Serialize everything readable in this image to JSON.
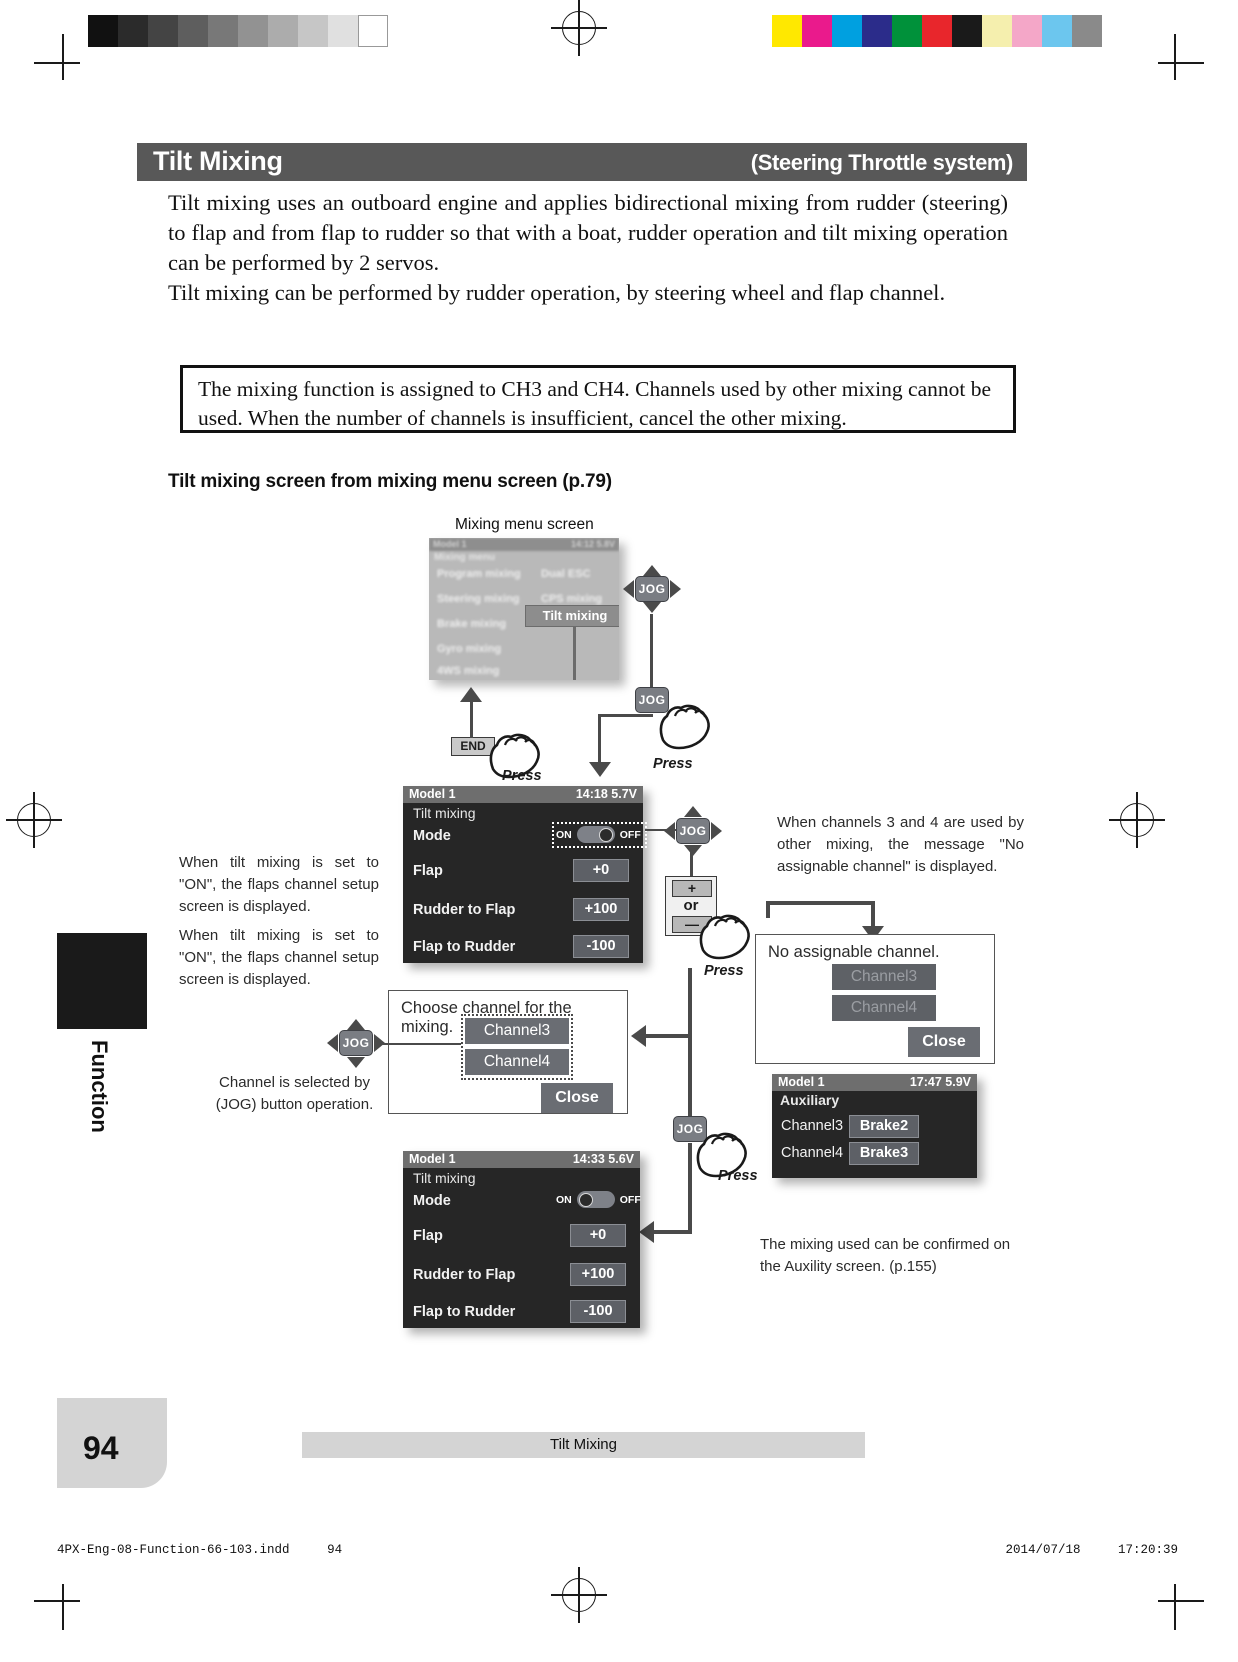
{
  "header": {
    "title": "Tilt Mixing",
    "subtitle": "(Steering Throttle system)"
  },
  "intro": {
    "paragraph1": "Tilt mixing uses an outboard engine and applies bidirectional mixing from rudder (steering) to flap and from flap to rudder so that with a boat, rudder operation and tilt mixing operation can be performed by 2 servos.",
    "paragraph2": "Tilt mixing can be performed by rudder operation, by steering wheel and flap channel."
  },
  "note_box": {
    "text": "The mixing function is assigned to CH3 and CH4. Channels used by other mixing cannot be used. When the number of channels is insufficient, cancel the other mixing."
  },
  "section_heading": "Tilt mixing screen from mixing menu screen (p.79)",
  "mixing_menu": {
    "caption": "Mixing menu screen",
    "model": "Model 1",
    "time": "14:12 5.8V",
    "screen_title": "Mixing menu",
    "items_left": [
      "Program mixing",
      "Steering mixing",
      "Brake mixing",
      "Gyro mixing",
      "4WS mixing"
    ],
    "items_right": [
      "Dual ESC",
      "CPS mixing"
    ],
    "highlighted": "Tilt mixing"
  },
  "screen_top": {
    "model": "Model 1",
    "time": "14:18 5.7V",
    "screen_title": "Tilt mixing",
    "rows": [
      {
        "label": "Mode",
        "value": "ON"
      },
      {
        "label": "Flap",
        "value": "+0"
      },
      {
        "label": "Rudder to Flap",
        "value": "+100"
      },
      {
        "label": "Flap to Rudder",
        "value": "-100"
      }
    ],
    "toggle_on": "ON",
    "toggle_off": "OFF",
    "toggle_state": "ON"
  },
  "screen_bottom": {
    "model": "Model 1",
    "time": "14:33 5.6V",
    "screen_title": "Tilt mixing",
    "rows": [
      {
        "label": "Mode",
        "value": "OFF"
      },
      {
        "label": "Flap",
        "value": "+0"
      },
      {
        "label": "Rudder to Flap",
        "value": "+100"
      },
      {
        "label": "Flap to Rudder",
        "value": "-100"
      }
    ],
    "toggle_on": "ON",
    "toggle_off": "OFF",
    "toggle_state": "OFF"
  },
  "dialog_choose": {
    "title": "Choose channel for the mixing.",
    "option1": "Channel3",
    "option2": "Channel4",
    "close": "Close"
  },
  "dialog_noassign": {
    "title": "No assignable channel.",
    "option1": "Channel3",
    "option2": "Channel4",
    "close": "Close"
  },
  "screen_aux": {
    "model": "Model 1",
    "time": "17:47 5.9V",
    "screen_title": "Auxiliary",
    "rows": [
      {
        "label": "Channel3",
        "value": "Brake2"
      },
      {
        "label": "Channel4",
        "value": "Brake3"
      }
    ]
  },
  "controls": {
    "jog": "JOG",
    "end": "END",
    "press": "Press",
    "plus": "+",
    "minus": "—",
    "or": "or"
  },
  "notes": {
    "left_note_1": "When tilt mixing is set to \"ON\", the flaps channel setup screen is displayed.",
    "left_note_2": "When tilt mixing is set to \"ON\", the flaps channel setup screen is displayed.",
    "jog_note": "Channel is selected by (JOG) button operation.",
    "right_note": "When channels 3 and 4 are used by other mixing, the message \"No assignable channel\" is displayed.",
    "aux_note": "The mixing used can be confirmed on the Auxility screen. (p.155)"
  },
  "sidebar": {
    "vertical_label": "Function"
  },
  "footer": {
    "page_number": "94",
    "band_label": "Tilt Mixing",
    "file_name": "4PX-Eng-08-Function-66-103.indd",
    "file_page": "94",
    "date": "2014/07/18",
    "time": "17:20:39"
  },
  "colors": {
    "band": "#585858",
    "lcd_bg": "#262626",
    "lcd_bar": "#6e6e6e",
    "value_btn": "#5d6066",
    "footer_grey": "#d4d4d4"
  },
  "print_swatches_gray": [
    "#111111",
    "#2b2b2b",
    "#444444",
    "#5e5e5e",
    "#787878",
    "#929292",
    "#acacac",
    "#c6c6c6",
    "#e0e0e0",
    "#ffffff"
  ],
  "print_swatches_color": [
    "#ffe800",
    "#ea1a8c",
    "#00a0e0",
    "#2b2c8a",
    "#00913a",
    "#e8262c",
    "#1a1a1a",
    "#f5efae",
    "#f4a7c8",
    "#6cc6ee",
    "#8a8a8a"
  ]
}
